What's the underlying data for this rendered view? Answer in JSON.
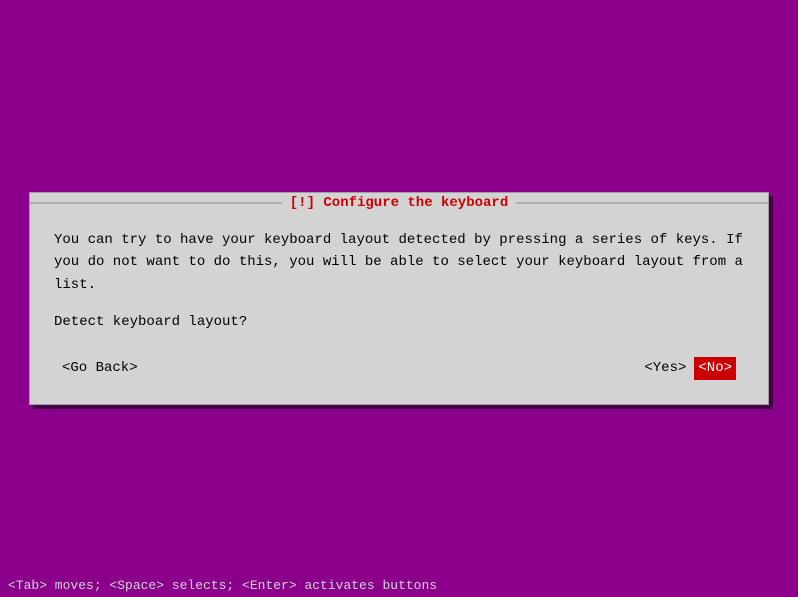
{
  "dialog": {
    "title": "[!] Configure the keyboard",
    "message": "You can try to have your keyboard layout detected by pressing a series of keys. If you do not want to do this, you will be able to select your keyboard layout from a list.",
    "question": "Detect keyboard layout?",
    "buttons": {
      "go_back": "<Go Back>",
      "yes": "<Yes>",
      "no": "<No>"
    }
  },
  "status_bar": {
    "text": "<Tab> moves; <Space> selects; <Enter> activates buttons"
  }
}
